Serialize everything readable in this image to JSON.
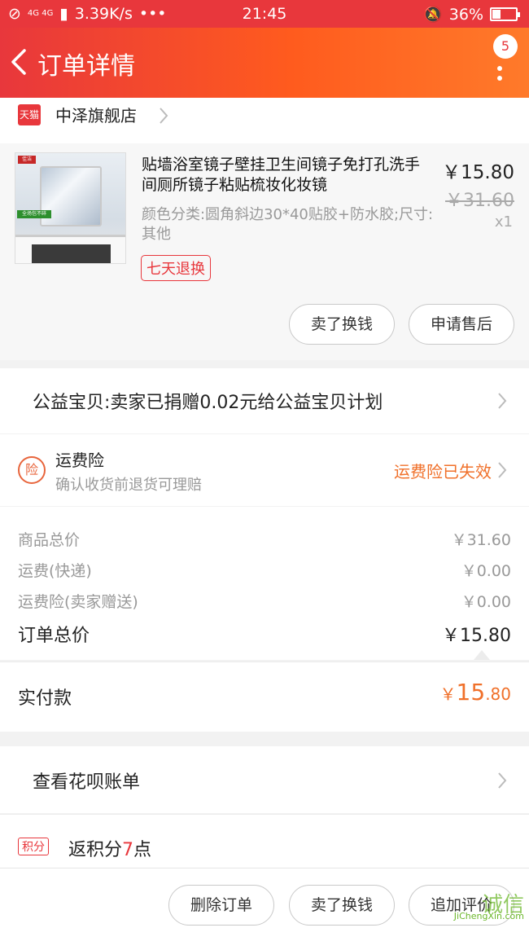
{
  "status_bar": {
    "network": "4G 4G",
    "speed": "3.39K/s",
    "dots": "•••",
    "time": "21:45",
    "battery": "36%",
    "battery_level": 0.36
  },
  "nav": {
    "title": "订单详情",
    "badge": "5",
    "back_icon": "chevron-left-icon",
    "more_icon": "more-vertical-icon"
  },
  "shop": {
    "logo_text": "天猫",
    "name": "中泽旗舰店"
  },
  "item": {
    "title": "贴墙浴室镜子壁挂卫生间镜子免打孔洗手间厕所镜子粘贴梳妆化妆镜",
    "sku": "颜色分类:圆角斜边30*40贴胶+防水胶;尺寸:其他",
    "return_tag": "七天退换",
    "price": "￥15.80",
    "original_price": "￥31.60",
    "quantity": "x1",
    "thumb_logo": "佳洁",
    "thumb_tag": "全场包不碎",
    "btn_resell": "卖了换钱",
    "btn_aftersale": "申请售后"
  },
  "charity": {
    "text": "公益宝贝:卖家已捐赠0.02元给公益宝贝计划"
  },
  "insurance": {
    "icon_text": "险",
    "title": "运费险",
    "subtitle": "确认收货前退货可理赔",
    "status": "运费险已失效"
  },
  "cost": {
    "rows": [
      {
        "label": "商品总价",
        "value": "￥31.60"
      },
      {
        "label": "运费(快递)",
        "value": "￥0.00"
      },
      {
        "label": "运费险(卖家赠送)",
        "value": "￥0.00"
      }
    ],
    "total_label": "订单总价",
    "total_value": "￥15.80"
  },
  "paid": {
    "label": "实付款",
    "currency": "￥",
    "int": "15",
    "dec": ".80"
  },
  "huabei": {
    "text": "查看花呗账单"
  },
  "points": {
    "tag": "积分",
    "prefix": "返积分",
    "num": "7",
    "suffix": "点"
  },
  "actions": {
    "delete": "删除订单",
    "resell": "卖了换钱",
    "review": "追加评价"
  },
  "watermark": {
    "text": "诚信",
    "url": "JiChengXin.com"
  },
  "colors": {
    "brand": "#e8373c",
    "orange": "#f0702a"
  }
}
